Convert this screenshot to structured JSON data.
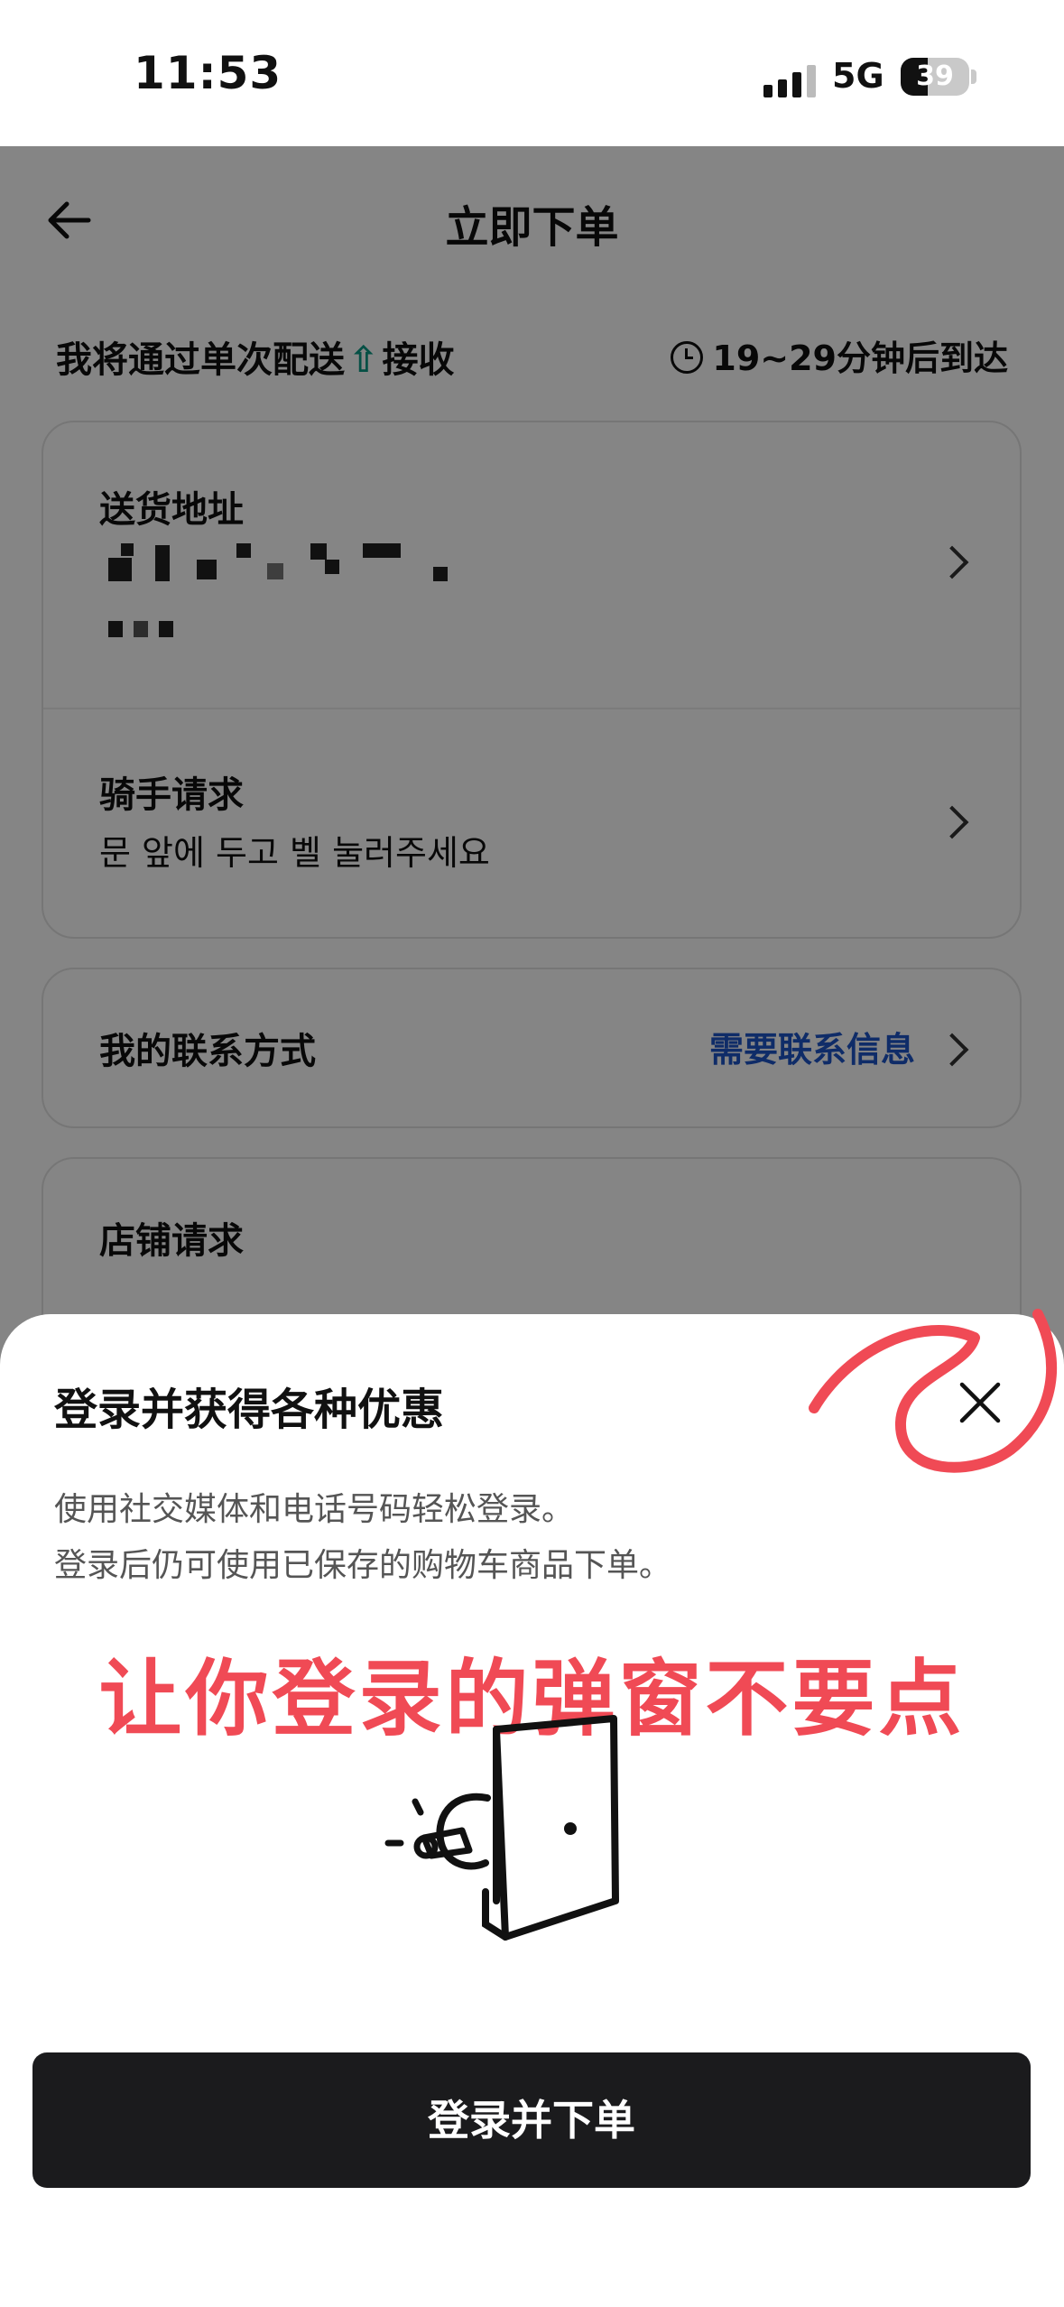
{
  "status_bar": {
    "time": "11:53",
    "network": "5G",
    "battery": "39"
  },
  "header": {
    "title": "立即下单"
  },
  "delivery": {
    "text_prefix": "我将通过单次配送",
    "logo_icon": "⇧",
    "text_suffix": "接收",
    "eta": "19~29分钟后到达"
  },
  "address_card": {
    "address_title": "送货地址",
    "rider_title": "骑手请求",
    "rider_note": "문 앞에 두고 벨 눌러주세요"
  },
  "contact_card": {
    "title": "我的联系方式",
    "link": "需要联系信息"
  },
  "store_card": {
    "title": "店铺请求"
  },
  "login_sheet": {
    "title": "登录并获得各种优惠",
    "desc_line1": "使用社交媒体和电话号码轻松登录。",
    "desc_line2": "登录后仍可使用已保存的购物车商品下单。",
    "annotation": "让你登录的弹窗不要点",
    "button": "登录并下单"
  },
  "colors": {
    "accent_link": "#1e55c8",
    "annotation_red": "#f04a55",
    "button_dark": "#1b1b1d",
    "logo_green": "#0a9a84"
  }
}
